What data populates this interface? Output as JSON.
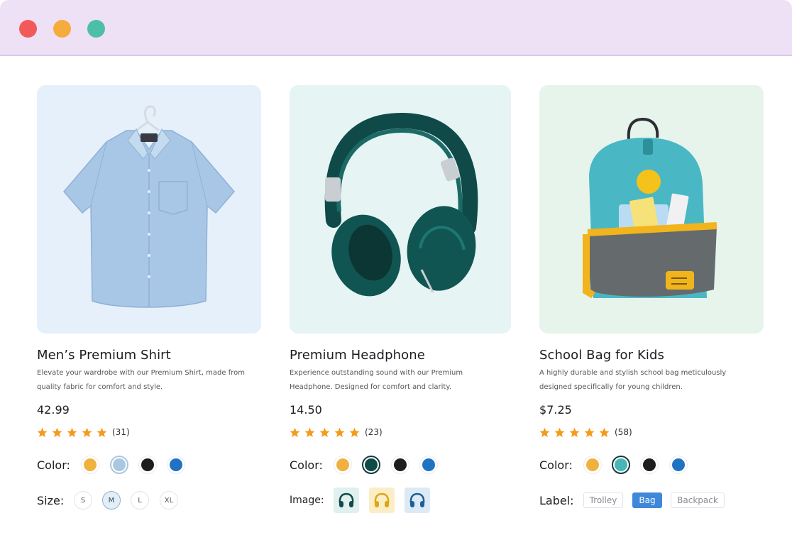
{
  "window": {
    "controls": {
      "close_color": "#f25a5a",
      "minimize_color": "#f6ac3c",
      "maximize_color": "#4dbfa6"
    },
    "titlebar_color": "#efe1f5"
  },
  "products": [
    {
      "title": "Men’s Premium Shirt",
      "description": "Elevate your wardrobe with our Premium Shirt, made from quality fabric for comfort and style.",
      "price": "42.99",
      "rating": 5,
      "review_count": "(31)",
      "image_bg": "#e6f0fb",
      "color_label": "Color:",
      "colors": [
        "#f0b23f",
        "#a9c7e0",
        "#1d1d1f",
        "#1f73c2"
      ],
      "selected_color": 1,
      "secondary_label": "Size:",
      "sizes": [
        "S",
        "M",
        "L",
        "XL"
      ],
      "selected_size": 1
    },
    {
      "title": "Premium Headphone",
      "description": "Experience outstanding sound with our Premium Headphone. Designed for comfort and clarity.",
      "price": "14.50",
      "rating": 5,
      "review_count": "(23)",
      "image_bg": "#e6f4f4",
      "color_label": "Color:",
      "colors": [
        "#f0b23f",
        "#0f4a48",
        "#1d1d1f",
        "#1f73c2"
      ],
      "selected_color": 1,
      "secondary_label": "Image:",
      "image_options": [
        "teal-headphone-icon",
        "yellow-headphone-icon",
        "blue-headphone-icon"
      ]
    },
    {
      "title": "School Bag for Kids",
      "description": "A highly durable and stylish school bag meticulously designed specifically for young children.",
      "price": "$7.25",
      "rating": 5,
      "review_count": "(58)",
      "image_bg": "#e6f4ec",
      "color_label": "Color:",
      "colors": [
        "#f0b23f",
        "#47b6b5",
        "#1d1d1f",
        "#1f73c2"
      ],
      "selected_color": 1,
      "secondary_label": "Label:",
      "labels": [
        "Trolley",
        "Bag",
        "Backpack"
      ],
      "selected_label": 1
    }
  ],
  "star_color": "#f59a1b"
}
